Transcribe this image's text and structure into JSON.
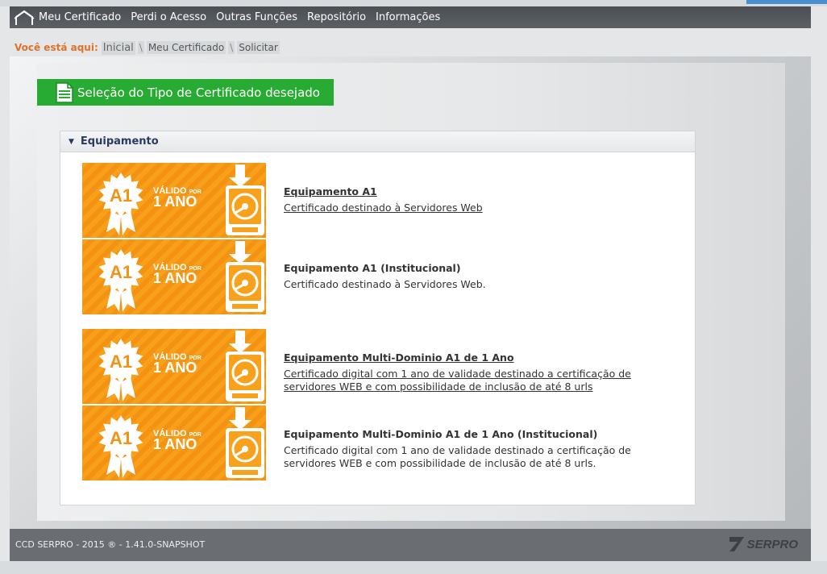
{
  "navbar": {
    "home_icon": "home-icon",
    "items": [
      "Meu Certificado",
      "Perdi o Acesso",
      "Outras Funções",
      "Repositório",
      "Informações"
    ]
  },
  "breadcrumb": {
    "label": "Você está aqui:",
    "items": [
      "Inicial",
      "Meu Certificado",
      "Solicitar"
    ],
    "separator": "\\"
  },
  "page_title": "Seleção do Tipo de Certificado desejado",
  "section": {
    "title": "Equipamento",
    "items": [
      {
        "title": "Equipamento A1",
        "desc": "Certificado destinado à Servidores Web",
        "banner": {
          "badge": "A1",
          "line1": "VÁLIDO",
          "line1b": "POR",
          "line2": "1 ANO"
        }
      },
      {
        "title": "Equipamento A1 (Institucional)",
        "desc": "Certificado destinado à Servidores Web.",
        "banner": {
          "badge": "A1",
          "line1": "VÁLIDO",
          "line1b": "POR",
          "line2": "1 ANO"
        }
      },
      {
        "title": "Equipamento Multi-Dominio A1 de 1 Ano",
        "desc_lines": [
          "Certificado digital com 1 ano de validade destinado a certificação de",
          "servidores WEB e com possibilidade de inclusão de até 8 urls"
        ],
        "banner": {
          "badge": "A1",
          "line1": "VÁLIDO",
          "line1b": "POR",
          "line2": "1 ANO"
        }
      },
      {
        "title": "Equipamento Multi-Dominio A1 de 1 Ano (Institucional)",
        "desc_lines": [
          "Certificado digital com 1 ano de validade destinado a certificação de",
          "servidores WEB e com possibilidade de inclusão de até 8 urls."
        ],
        "banner": {
          "badge": "A1",
          "line1": "VÁLIDO",
          "line1b": "POR",
          "line2": "1 ANO"
        }
      }
    ]
  },
  "footer": {
    "text": "CCD SERPRO - 2015 ® - 1.41.0-SNAPSHOT",
    "logo_text": "SERPRO"
  },
  "colors": {
    "accent_green": "#27ab32",
    "breadcrumb_label": "#e0722a",
    "banner_orange": "#f8a01a",
    "nav_bg": "#53575c"
  }
}
